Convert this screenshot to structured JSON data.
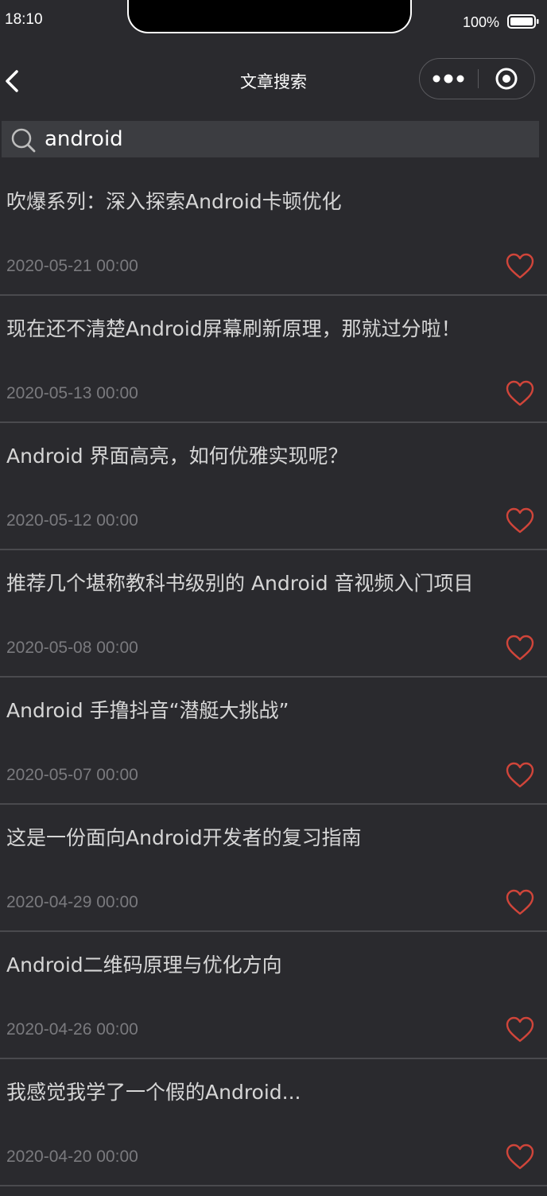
{
  "status_bar": {
    "time": "18:10",
    "battery_percent": "100%",
    "battery_level": 1.0
  },
  "nav": {
    "title": "文章搜索",
    "back_icon": "chevron-left-icon",
    "more_icon": "more-dots-icon",
    "close_icon": "target-circle-icon"
  },
  "search": {
    "value": "android",
    "icon": "search-icon"
  },
  "colors": {
    "background": "#2a2a2e",
    "search_background": "#3c3d41",
    "heart": "#d0453a",
    "divider": "#4a4a4e",
    "date_text": "#7a7a7e"
  },
  "articles": [
    {
      "title": "吹爆系列：深入探索Android卡顿优化",
      "date": "2020-05-21 00:00"
    },
    {
      "title": "现在还不清楚Android屏幕刷新原理，那就过分啦！",
      "date": "2020-05-13 00:00"
    },
    {
      "title": "Android 界面高亮，如何优雅实现呢？",
      "date": "2020-05-12 00:00"
    },
    {
      "title": "推荐几个堪称教科书级别的 Android 音视频入门项目",
      "date": "2020-05-08 00:00"
    },
    {
      "title": "Android 手撸抖音“潜艇大挑战”",
      "date": "2020-05-07 00:00"
    },
    {
      "title": "这是一份面向Android开发者的复习指南",
      "date": "2020-04-29 00:00"
    },
    {
      "title": "Android二维码原理与优化方向",
      "date": "2020-04-26 00:00"
    },
    {
      "title": "我感觉我学了一个假的Android...",
      "date": "2020-04-20 00:00"
    }
  ]
}
